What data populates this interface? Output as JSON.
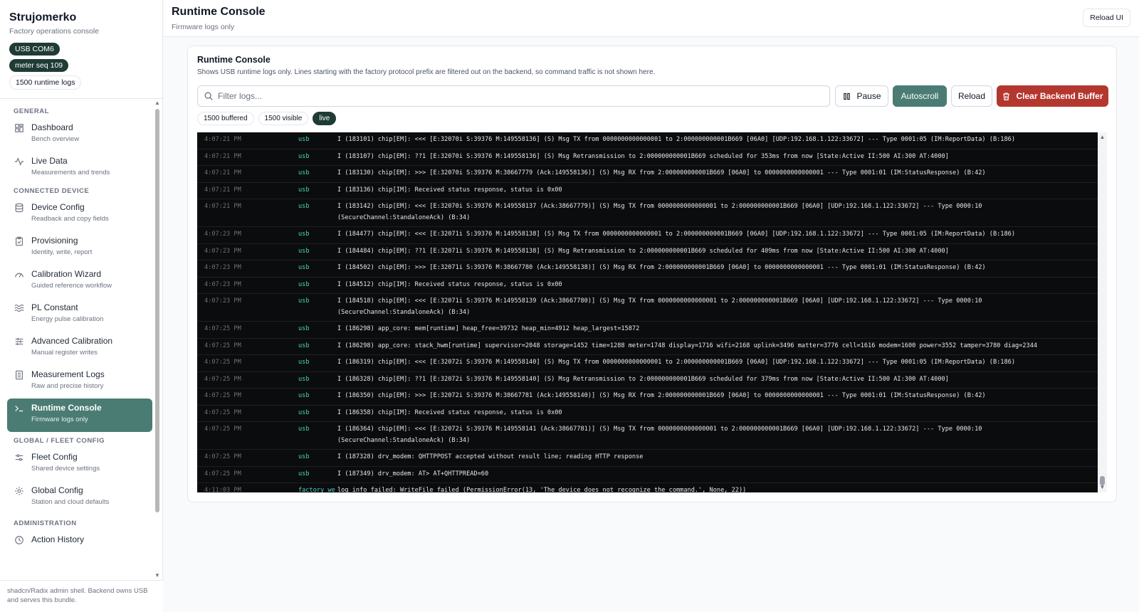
{
  "brand": {
    "title": "Strujomerko",
    "subtitle": "Factory operations console",
    "pills": [
      "USB COM6",
      "meter seq 109",
      "1500 runtime logs"
    ]
  },
  "nav": {
    "sections": [
      {
        "title": "GENERAL",
        "items": [
          {
            "label": "Dashboard",
            "desc": "Bench overview",
            "icon": "grid-icon"
          },
          {
            "label": "Live Data",
            "desc": "Measurements and trends",
            "icon": "activity-icon"
          }
        ]
      },
      {
        "title": "CONNECTED DEVICE",
        "items": [
          {
            "label": "Device Config",
            "desc": "Readback and copy fields",
            "icon": "database-icon"
          },
          {
            "label": "Provisioning",
            "desc": "Identity, write, report",
            "icon": "clipboard-icon"
          },
          {
            "label": "Calibration Wizard",
            "desc": "Guided reference workflow",
            "icon": "gauge-icon"
          },
          {
            "label": "PL Constant",
            "desc": "Energy pulse calibration",
            "icon": "waves-icon"
          },
          {
            "label": "Advanced Calibration",
            "desc": "Manual register writes",
            "icon": "sliders-icon"
          },
          {
            "label": "Measurement Logs",
            "desc": "Raw and precise history",
            "icon": "file-list-icon"
          },
          {
            "label": "Runtime Console",
            "desc": "Firmware logs only",
            "icon": "terminal-icon"
          }
        ]
      },
      {
        "title": "GLOBAL / FLEET CONFIG",
        "items": [
          {
            "label": "Fleet Config",
            "desc": "Shared device settings",
            "icon": "settings-sliders-icon"
          },
          {
            "label": "Global Config",
            "desc": "Station and cloud defaults",
            "icon": "gear-icon"
          }
        ]
      },
      {
        "title": "ADMINISTRATION",
        "items": [
          {
            "label": "Action History",
            "desc": "",
            "icon": "history-icon"
          }
        ]
      }
    ],
    "footer": "shadcn/Radix admin shell. Backend owns USB and serves this bundle."
  },
  "header": {
    "title": "Runtime Console",
    "subtitle": "Firmware logs only",
    "reload_label": "Reload UI"
  },
  "console": {
    "title": "Runtime Console",
    "description": "Shows USB runtime logs only. Lines starting with the factory protocol prefix are filtered out on the backend, so command traffic is not shown here.",
    "filter_placeholder": "Filter logs...",
    "buttons": {
      "pause": "Pause",
      "autoscroll": "Autoscroll",
      "reload": "Reload",
      "clear": "Clear Backend Buffer"
    },
    "stats": {
      "buffered": "1500 buffered",
      "visible": "1500 visible",
      "live": "live"
    },
    "logs": [
      {
        "time": "4:07:21 PM",
        "src": "usb",
        "msg": "I (183101) chip[EM]: <<< [E:32070i S:39376 M:149558136] (S) Msg TX from 0000000000000001 to 2:000000000001B669 [06A0] [UDP:192.168.1.122:33672] --- Type 0001:05 (IM:ReportData) (B:186)"
      },
      {
        "time": "4:07:21 PM",
        "src": "usb",
        "msg": "I (183107) chip[EM]: ??1 [E:32070i S:39376 M:149558136] (S) Msg Retransmission to 2:000000000001B669 scheduled for 353ms from now [State:Active II:500 AI:300 AT:4000]"
      },
      {
        "time": "4:07:21 PM",
        "src": "usb",
        "msg": "I (183130) chip[EM]: >>> [E:32070i S:39376 M:38667779 (Ack:149558136)] (S) Msg RX from 2:000000000001B669 [06A0] to 0000000000000001 --- Type 0001:01 (IM:StatusResponse) (B:42)"
      },
      {
        "time": "4:07:21 PM",
        "src": "usb",
        "msg": "I (183136) chip[IM]: Received status response, status is 0x00"
      },
      {
        "time": "4:07:21 PM",
        "src": "usb",
        "msg": "I (183142) chip[EM]: <<< [E:32070i S:39376 M:149558137 (Ack:38667779)] (S) Msg TX from 0000000000000001 to 2:000000000001B669 [06A0] [UDP:192.168.1.122:33672] --- Type 0000:10\n(SecureChannel:StandaloneAck) (B:34)"
      },
      {
        "time": "4:07:23 PM",
        "src": "usb",
        "msg": "I (184477) chip[EM]: <<< [E:32071i S:39376 M:149558138] (S) Msg TX from 0000000000000001 to 2:000000000001B669 [06A0] [UDP:192.168.1.122:33672] --- Type 0001:05 (IM:ReportData) (B:186)"
      },
      {
        "time": "4:07:23 PM",
        "src": "usb",
        "msg": "I (184484) chip[EM]: ??1 [E:32071i S:39376 M:149558138] (S) Msg Retransmission to 2:000000000001B669 scheduled for 409ms from now [State:Active II:500 AI:300 AT:4000]"
      },
      {
        "time": "4:07:23 PM",
        "src": "usb",
        "msg": "I (184502) chip[EM]: >>> [E:32071i S:39376 M:38667780 (Ack:149558138)] (S) Msg RX from 2:000000000001B669 [06A0] to 0000000000000001 --- Type 0001:01 (IM:StatusResponse) (B:42)"
      },
      {
        "time": "4:07:23 PM",
        "src": "usb",
        "msg": "I (184512) chip[IM]: Received status response, status is 0x00"
      },
      {
        "time": "4:07:23 PM",
        "src": "usb",
        "msg": "I (184518) chip[EM]: <<< [E:32071i S:39376 M:149558139 (Ack:38667780)] (S) Msg TX from 0000000000000001 to 2:000000000001B669 [06A0] [UDP:192.168.1.122:33672] --- Type 0000:10\n(SecureChannel:StandaloneAck) (B:34)"
      },
      {
        "time": "4:07:25 PM",
        "src": "usb",
        "msg": "I (186298) app_core: mem[runtime] heap_free=39732 heap_min=4912 heap_largest=15872"
      },
      {
        "time": "4:07:25 PM",
        "src": "usb",
        "msg": "I (186298) app_core: stack_hwm[runtime] supervisor=2048 storage=1452 time=1288 meter=1748 display=1716 wifi=2168 uplink=3496 matter=3776 cell=1616 modem=1600 power=3552 tamper=3780 diag=2344"
      },
      {
        "time": "4:07:25 PM",
        "src": "usb",
        "msg": "I (186319) chip[EM]: <<< [E:32072i S:39376 M:149558140] (S) Msg TX from 0000000000000001 to 2:000000000001B669 [06A0] [UDP:192.168.1.122:33672] --- Type 0001:05 (IM:ReportData) (B:186)"
      },
      {
        "time": "4:07:25 PM",
        "src": "usb",
        "msg": "I (186328) chip[EM]: ??1 [E:32072i S:39376 M:149558140] (S) Msg Retransmission to 2:000000000001B669 scheduled for 379ms from now [State:Active II:500 AI:300 AT:4000]"
      },
      {
        "time": "4:07:25 PM",
        "src": "usb",
        "msg": "I (186350) chip[EM]: >>> [E:32072i S:39376 M:38667781 (Ack:149558140)] (S) Msg RX from 2:000000000001B669 [06A0] to 0000000000000001 --- Type 0001:01 (IM:StatusResponse) (B:42)"
      },
      {
        "time": "4:07:25 PM",
        "src": "usb",
        "msg": "I (186358) chip[IM]: Received status response, status is 0x00"
      },
      {
        "time": "4:07:25 PM",
        "src": "usb",
        "msg": "I (186364) chip[EM]: <<< [E:32072i S:39376 M:149558141 (Ack:38667781)] (S) Msg TX from 0000000000000001 to 2:000000000001B669 [06A0] [UDP:192.168.1.122:33672] --- Type 0000:10\n(SecureChannel:StandaloneAck) (B:34)"
      },
      {
        "time": "4:07:25 PM",
        "src": "usb",
        "msg": "I (187328) drv_modem: QHTTPPOST accepted without result line; reading HTTP response"
      },
      {
        "time": "4:07:25 PM",
        "src": "usb",
        "msg": "I (187349) drv_modem: AT> AT+QHTTPREAD=60"
      },
      {
        "time": "4:11:03 PM",
        "src": "factory_we",
        "msg": "log_info failed: WriteFile failed (PermissionError(13, 'The device does not recognize the command.', None, 22))"
      }
    ]
  }
}
